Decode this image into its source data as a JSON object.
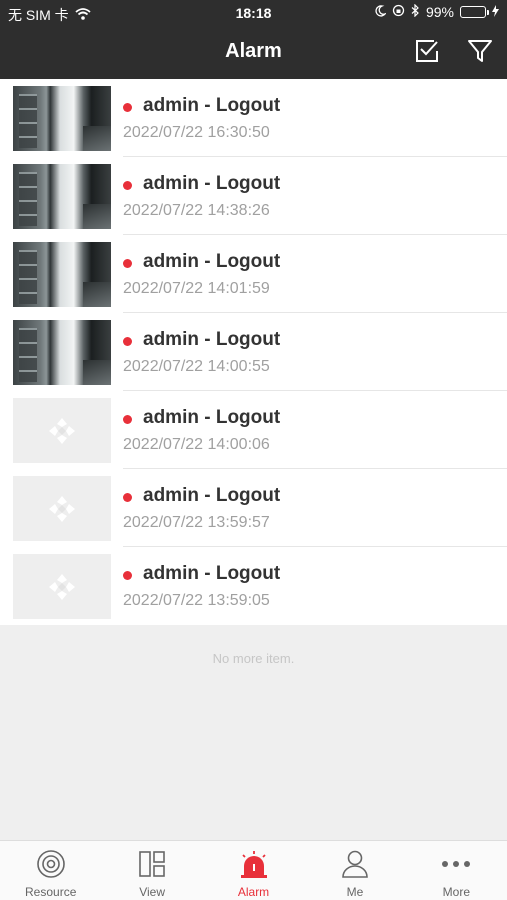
{
  "status_bar": {
    "carrier": "无 SIM 卡",
    "time": "18:18",
    "battery_text": "99%",
    "battery_level": 0.99,
    "battery_color": "#4cd964"
  },
  "header": {
    "title": "Alarm",
    "select_icon": "checkbox-icon",
    "filter_icon": "filter-icon",
    "background_color": "#2e2e2e"
  },
  "alarms": [
    {
      "title": "admin - Logout",
      "time": "2022/07/22 16:30:50",
      "thumbnail": "camera-snapshot"
    },
    {
      "title": "admin - Logout",
      "time": "2022/07/22 14:38:26",
      "thumbnail": "camera-snapshot"
    },
    {
      "title": "admin - Logout",
      "time": "2022/07/22 14:01:59",
      "thumbnail": "camera-snapshot"
    },
    {
      "title": "admin - Logout",
      "time": "2022/07/22 14:00:55",
      "thumbnail": "camera-snapshot"
    },
    {
      "title": "admin - Logout",
      "time": "2022/07/22 14:00:06",
      "thumbnail": "placeholder"
    },
    {
      "title": "admin - Logout",
      "time": "2022/07/22 13:59:57",
      "thumbnail": "placeholder"
    },
    {
      "title": "admin - Logout",
      "time": "2022/07/22 13:59:05",
      "thumbnail": "placeholder"
    }
  ],
  "unread_dot_color": "#e8303a",
  "list_footer": "No more item.",
  "tabs": [
    {
      "label": "Resource",
      "icon": "resource-icon",
      "active": false
    },
    {
      "label": "View",
      "icon": "view-icon",
      "active": false
    },
    {
      "label": "Alarm",
      "icon": "alarm-icon",
      "active": true
    },
    {
      "label": "Me",
      "icon": "person-icon",
      "active": false
    },
    {
      "label": "More",
      "icon": "more-icon",
      "active": false
    }
  ],
  "accent_color": "#e8303a"
}
